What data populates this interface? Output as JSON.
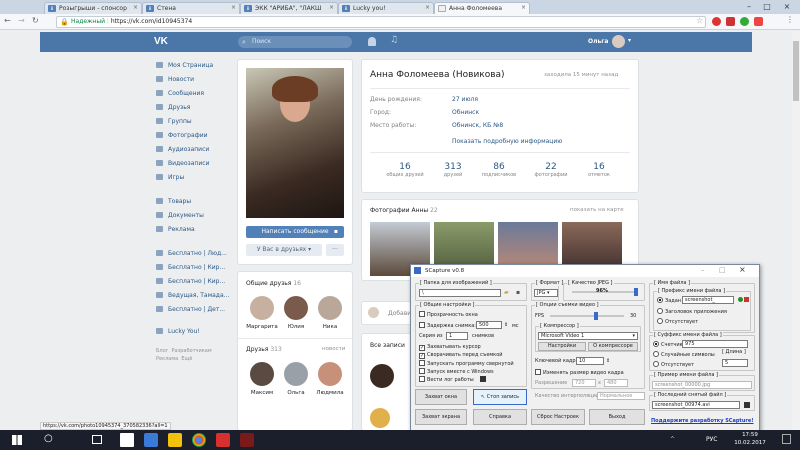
{
  "browser": {
    "tabs": [
      {
        "label": "Розыгрыши - спонсор"
      },
      {
        "label": "Стена"
      },
      {
        "label": "ЭКК \"АРИБА\", \"ЛАКШ"
      },
      {
        "label": "Lucky you!"
      },
      {
        "label": "Анна Фоломеева"
      }
    ],
    "secure_label": "Надежный",
    "url": "https://vk.com/id10945374",
    "status_url": "https://vk.com/photo10945374_370582336?all=1"
  },
  "vk": {
    "logo": "VK",
    "search_placeholder": "Поиск",
    "user_name": "Ольга",
    "nav": [
      "Моя Страница",
      "Новости",
      "Сообщения",
      "Друзья",
      "Группы",
      "Фотографии",
      "Аудиозаписи",
      "Видеозаписи",
      "Игры"
    ],
    "nav2": [
      "Товары",
      "Документы",
      "Реклама"
    ],
    "nav3": [
      "Бесплатно | Люд...",
      "Бесплатно | Кир...",
      "Бесплатно | Кир...",
      "Ведущая, Тамада...",
      "Бесплатно | Дет..."
    ],
    "nav4": [
      "Lucky You!"
    ],
    "footer_links": [
      "Блог",
      "Разработчикам",
      "Реклама",
      "Ещё"
    ],
    "profile": {
      "name": "Анна Фоломеева (Новикова)",
      "online": "заходила 15 минут назад",
      "fields": [
        {
          "label": "День рождения:",
          "value": "27 июля"
        },
        {
          "label": "Город:",
          "value": "Обнинск"
        },
        {
          "label": "Место работы:",
          "value": "Обнинск, КБ №8"
        }
      ],
      "more": "Показать подробную информацию",
      "counters": [
        {
          "n": "16",
          "l": "общих друзей"
        },
        {
          "n": "313",
          "l": "друзей"
        },
        {
          "n": "86",
          "l": "подписчиков"
        },
        {
          "n": "22",
          "l": "фотографии"
        },
        {
          "n": "16",
          "l": "отметок"
        }
      ],
      "write_btn": "Написать сообщение",
      "friends_btn": "У Вас в друзьях"
    },
    "photos_title": "Фотографии Анны",
    "photos_count": "22",
    "show_on_map": "показать на карте",
    "common_friends": {
      "title": "Общие друзья",
      "count": "16",
      "names": [
        "Маргарита",
        "Юлия",
        "Ника"
      ]
    },
    "friends": {
      "title": "Друзья",
      "count": "313",
      "link": "новости",
      "names": [
        "Максим",
        "Ольга",
        "Людмила"
      ]
    },
    "add_post": "Добави",
    "all_posts": "Все записи"
  },
  "scapture": {
    "title": "SCapture v0.8",
    "folder_group": "[ Папка для изображений ]",
    "folder_value": "\\",
    "format_group": "[ Формат ]",
    "format_value": "JPG",
    "quality_group": "[ Качество JPEG ]",
    "quality_value": "96%",
    "filename_group": "[ Имя файла ]",
    "prefix_group": "[ Префикс имени файла ]",
    "prefix_opts": [
      "Задан",
      "Заголовок приложения",
      "Отсутствует"
    ],
    "prefix_value": "screenshot_",
    "general_group": "[ Общие настройки ]",
    "opts": [
      "Прозрачность окна",
      "Задержка снимка:",
      "Серия из",
      "Захватывать курсор",
      "Сворачивать перед съемкой",
      "Запускать программу свернутой",
      "Запуск вместе с Windows",
      "Вести лог работы"
    ],
    "delay_value": "500",
    "delay_unit": "мс",
    "series_value": "1",
    "series_unit": "снимков",
    "video_group": "[ Опции съемки видео ]",
    "fps_label": "FPS",
    "fps_value": "30",
    "compressor_group": "[ Компрессор ]",
    "compressor_value": "Microsoft Video 1",
    "settings_btn": "Настройки",
    "about_btn": "О компрессоре",
    "keyframe_label": "Ключевой кадр",
    "keyframe_value": "10",
    "resize_label": "Изменять размер видео кадра",
    "resolution_label": "Разрешение",
    "res_w": "720",
    "res_h": "480",
    "quality_interp": "Качество интерполяции",
    "interp_value": "Нормальное",
    "suffix_group": "[ Суффикс имени файла ]",
    "suffix_opts": [
      "Счетчик",
      "Случайные символы",
      "Отсутствует"
    ],
    "suffix_value": "975",
    "length_label": "[ Длина ]",
    "length_value": "5",
    "example_group": "[ Пример имени файла ]",
    "example_value": "screenshot_00000.jpg",
    "last_group": "[ Последний снятый файл ]",
    "last_value": "screenshot_00974.avi",
    "support_link": "Поддержите разработку SCapture!",
    "buttons": [
      "Захват окна",
      "Стоп запись",
      "Захват экрана",
      "Справка",
      "Сброс Настроек",
      "Выход"
    ]
  },
  "taskbar": {
    "lang": "РУС",
    "time": "17:59",
    "date": "10.02.2017"
  }
}
